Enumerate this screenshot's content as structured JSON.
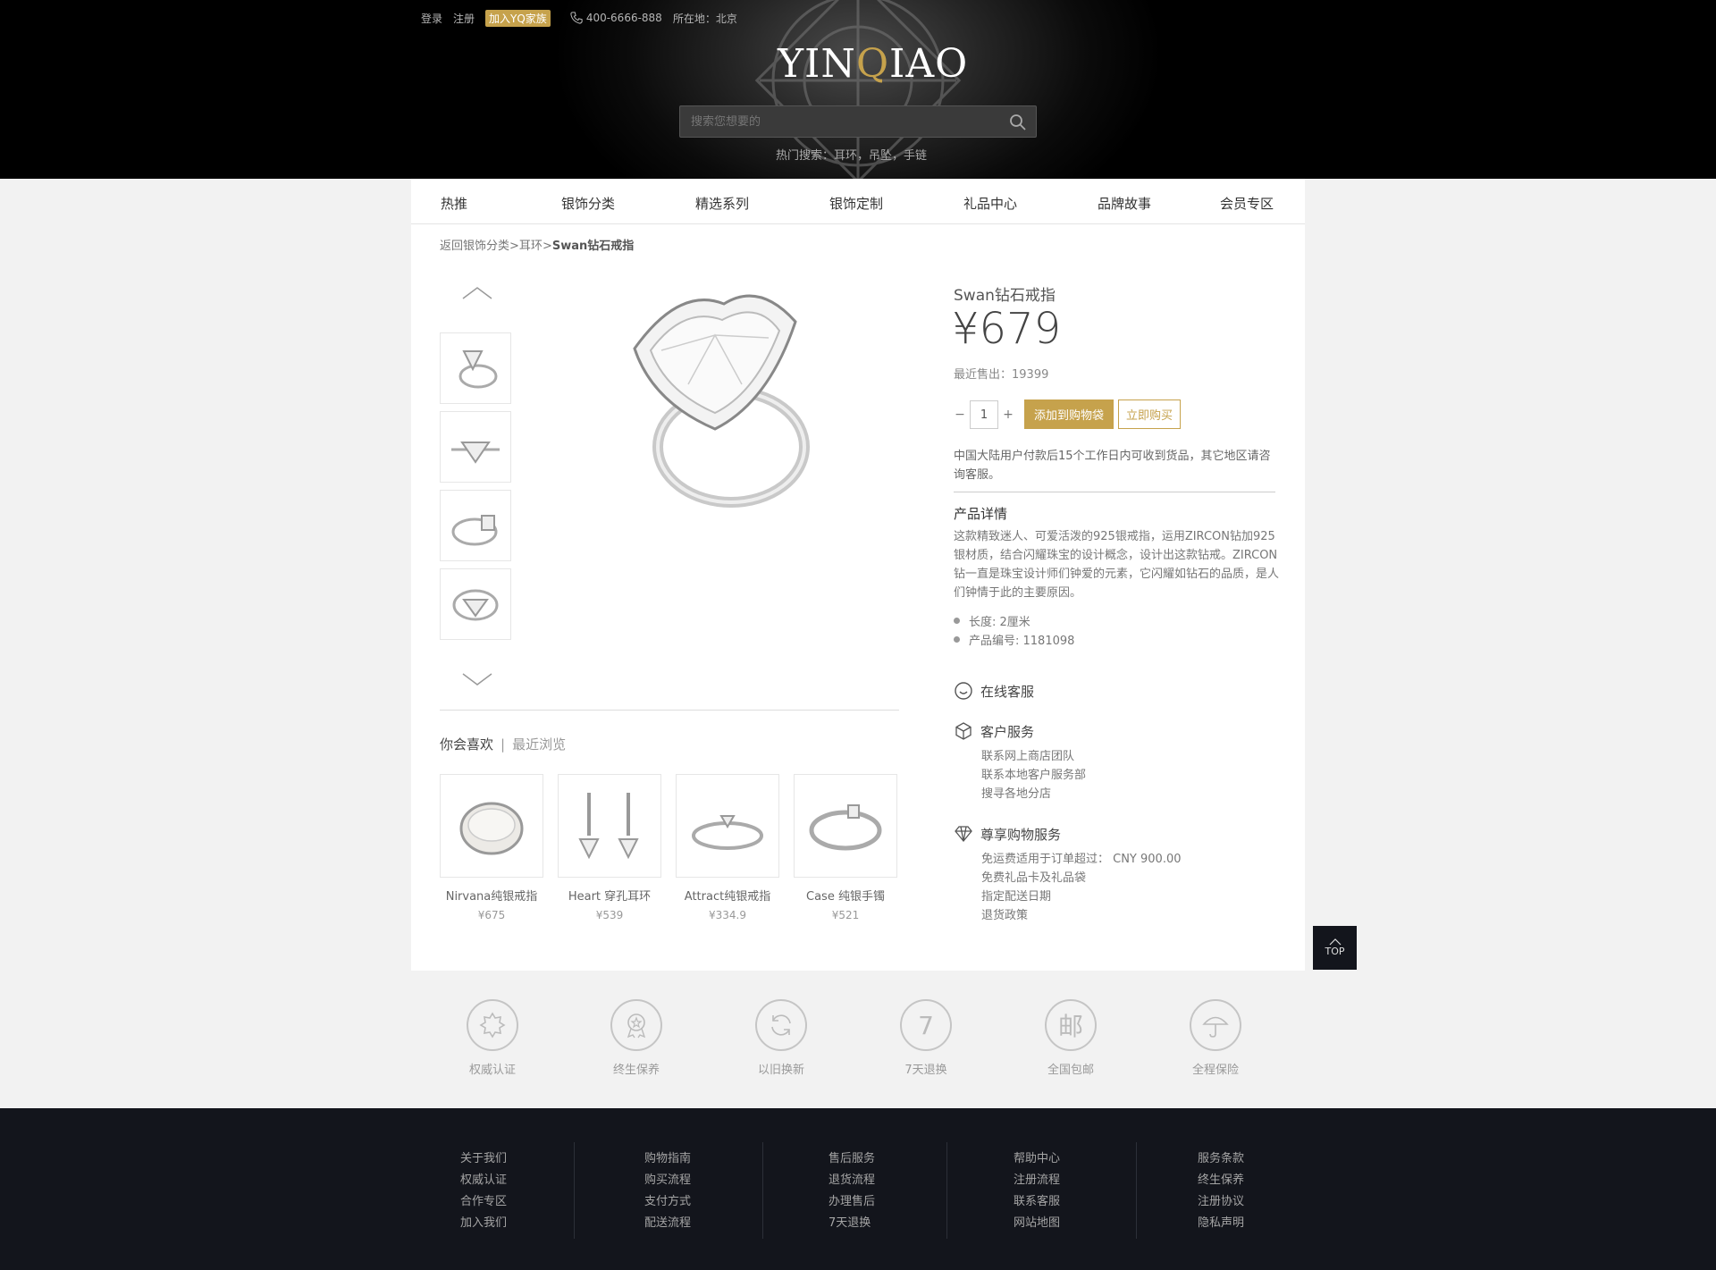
{
  "topbar": {
    "login": "登录",
    "register": "注册",
    "join": "加入YQ家族",
    "phone": "400-6666-888",
    "location": "所在地：北京"
  },
  "logo": {
    "pre": "YIN",
    "q": "Q",
    "post": "IAO"
  },
  "search": {
    "placeholder": "搜索您想要的"
  },
  "hot_search": "热门搜索：耳环，吊坠，手链",
  "nav": [
    "热推",
    "银饰分类",
    "精选系列",
    "银饰定制",
    "礼品中心",
    "品牌故事",
    "会员专区"
  ],
  "breadcrumb": {
    "back": "返回银饰分类",
    "sep1": ">",
    "cat": "耳环",
    "sep2": ">",
    "current": "Swan钻石戒指"
  },
  "product": {
    "name": "Swan钻石戒指",
    "price": "¥679",
    "sold": "最近售出：19399",
    "qty_minus": "−",
    "qty": "1",
    "qty_plus": "+",
    "add_cart": "添加到购物袋",
    "buy_now": "立即购买",
    "shipping": "中国大陆用户付款后15个工作日内可收到货品，其它地区请咨询客服。",
    "detail_title": "产品详情",
    "detail_text": "这款精致迷人、可爱活泼的925银戒指，运用ZIRCON钻加925银材质，结合闪耀珠宝的设计概念，设计出这款钻戒。ZIRCON钻一直是珠宝设计师们钟爱的元素，它闪耀如钻石的品质，是人们钟情于此的主要原因。",
    "specs": [
      "长度: 2厘米",
      "产品编号: 1181098"
    ]
  },
  "services": {
    "online": "在线客服",
    "customer": "客户服务",
    "customer_items": [
      "联系网上商店团队",
      "联系本地客户服务部",
      "搜寻各地分店"
    ],
    "vip": "尊享购物服务",
    "vip_items": [
      "免运费适用于订单超过： CNY 900.00",
      "免费礼品卡及礼品袋",
      "指定配送日期",
      "退货政策"
    ]
  },
  "tabs": {
    "like": "你会喜欢",
    "sep": "|",
    "recent": "最近浏览"
  },
  "recommend": [
    {
      "name": "Nirvana纯银戒指",
      "price": "¥675"
    },
    {
      "name": "Heart 穿孔耳环",
      "price": "¥539"
    },
    {
      "name": "Attract纯银戒指",
      "price": "¥334.9"
    },
    {
      "name": "Case 纯银手镯",
      "price": "¥521"
    }
  ],
  "top_label": "TOP",
  "badges": [
    {
      "label": "权威认证"
    },
    {
      "label": "终生保养"
    },
    {
      "label": "以旧换新"
    },
    {
      "label": "7天退换",
      "glyph": "7"
    },
    {
      "label": "全国包邮",
      "glyph": "邮"
    },
    {
      "label": "全程保险"
    }
  ],
  "footer": [
    [
      "关于我们",
      "权威认证",
      "合作专区",
      "加入我们"
    ],
    [
      "购物指南",
      "购买流程",
      "支付方式",
      "配送流程"
    ],
    [
      "售后服务",
      "退货流程",
      "办理售后",
      "7天退换"
    ],
    [
      "帮助中心",
      "注册流程",
      "联系客服",
      "网站地图"
    ],
    [
      "服务条款",
      "终生保养",
      "注册协议",
      "隐私声明"
    ]
  ],
  "colors": {
    "accent": "#c6a24c",
    "header_bg": "#000000",
    "footer_bg": "#13151c"
  }
}
